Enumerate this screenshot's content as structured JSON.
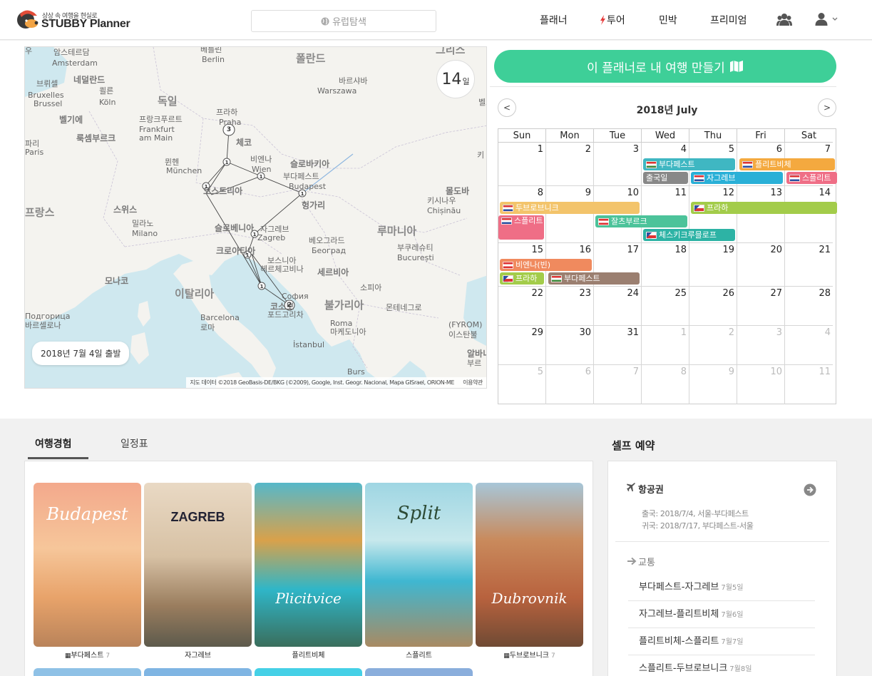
{
  "header": {
    "logo_tagline": "상상 속 여행을 현실로",
    "logo_name": "STUBBY Planner",
    "search_placeholder": "유럽탐색",
    "nav": {
      "planner": "플래너",
      "tour": "투어",
      "lodging": "민박",
      "premium": "프리미엄"
    },
    "icons": [
      "globe-icon",
      "bolt-icon",
      "group-icon",
      "user-icon",
      "chevron-down-icon"
    ]
  },
  "map": {
    "days_number": "14",
    "days_unit": "일",
    "departure": "2018년 7월 4일 출발",
    "attribution": "지도 데이터 ©2018 GeoBasis-DE/BKG (©2009), Google, Inst. Geogr. Nacional, Mapa GISrael, ORION-ME",
    "terms": "이용약관",
    "labels": [
      {
        "t": "폴란드",
        "c": "big"
      },
      {
        "t": "독일",
        "c": "big"
      },
      {
        "t": "이탈리아",
        "c": "big"
      },
      {
        "t": "루마니아",
        "c": "big"
      },
      {
        "t": "프랑스",
        "c": "big"
      },
      {
        "t": "암스테르담"
      },
      {
        "t": "Amsterdam"
      },
      {
        "t": "베를린"
      },
      {
        "t": "Berlin"
      },
      {
        "t": "네덜란드",
        "c": "country"
      },
      {
        "t": "브뤼셀"
      },
      {
        "t": "Bruxelles"
      },
      {
        "t": "Brussel"
      },
      {
        "t": "쾰른"
      },
      {
        "t": "Köln"
      },
      {
        "t": "벨기에",
        "c": "country"
      },
      {
        "t": "바르샤바"
      },
      {
        "t": "Warszawa"
      },
      {
        "t": "프라하"
      },
      {
        "t": "Praha"
      },
      {
        "t": "프랑크푸르트"
      },
      {
        "t": "Frankfurt"
      },
      {
        "t": "am Main"
      },
      {
        "t": "룩셈부르크",
        "c": "country"
      },
      {
        "t": "체코",
        "c": "country"
      },
      {
        "t": "파리"
      },
      {
        "t": "Paris"
      },
      {
        "t": "뮌헨"
      },
      {
        "t": "München"
      },
      {
        "t": "비엔나"
      },
      {
        "t": "Wien"
      },
      {
        "t": "슬로바키아",
        "c": "country"
      },
      {
        "t": "부다페스트"
      },
      {
        "t": "Budapest"
      },
      {
        "t": "오스트리아",
        "c": "country"
      },
      {
        "t": "몰도바",
        "c": "country"
      },
      {
        "t": "키시나우"
      },
      {
        "t": "Chișinău"
      },
      {
        "t": "스위스",
        "c": "country"
      },
      {
        "t": "헝가리",
        "c": "country"
      },
      {
        "t": "밀라노"
      },
      {
        "t": "Milano"
      },
      {
        "t": "슬로베니아",
        "c": "country"
      },
      {
        "t": "자그레브"
      },
      {
        "t": "Zagreb"
      },
      {
        "t": "베오그라드"
      },
      {
        "t": "Београд"
      },
      {
        "t": "크로아티아",
        "c": "country"
      },
      {
        "t": "부쿠레슈티"
      },
      {
        "t": "București"
      },
      {
        "t": "보스니아"
      },
      {
        "t": "헤르체고비나"
      },
      {
        "t": "세르비아",
        "c": "country"
      },
      {
        "t": "모나코",
        "c": "country"
      },
      {
        "t": "소피아"
      },
      {
        "t": "София"
      },
      {
        "t": "몬테네그로"
      },
      {
        "t": "불가리아",
        "c": "big"
      },
      {
        "t": "코소보",
        "c": "country"
      },
      {
        "t": "포드고리차"
      },
      {
        "t": "Подгорица"
      },
      {
        "t": "바르셀로나"
      },
      {
        "t": "Barcelona"
      },
      {
        "t": "로마"
      },
      {
        "t": "Roma"
      },
      {
        "t": "마케도니아"
      },
      {
        "t": "(FYROM)"
      },
      {
        "t": "이스탄불"
      },
      {
        "t": "İstanbul"
      },
      {
        "t": "알바니아",
        "c": "country"
      },
      {
        "t": "부르"
      },
      {
        "t": "Burs"
      },
      {
        "t": "그리스",
        "c": "big"
      },
      {
        "t": "벨로루시"
      },
      {
        "t": "키"
      },
      {
        "t": "우"
      }
    ],
    "route_labels": [
      "3",
      "1",
      "1",
      "1",
      "1",
      "1",
      "1",
      "1",
      "2",
      "1"
    ]
  },
  "cta_label": "이 플래너로 내 여행 만들기",
  "calendar": {
    "title": "2018년 July",
    "prev": "<",
    "next": ">",
    "weekdays": [
      "Sun",
      "Mon",
      "Tue",
      "Wed",
      "Thu",
      "Fri",
      "Sat"
    ],
    "weeks": [
      [
        "1",
        "2",
        "3",
        "4",
        "5",
        "6",
        "7"
      ],
      [
        "8",
        "9",
        "10",
        "11",
        "12",
        "13",
        "14"
      ],
      [
        "15",
        "16",
        "17",
        "18",
        "19",
        "20",
        "21"
      ],
      [
        "22",
        "23",
        "24",
        "25",
        "26",
        "27",
        "28"
      ],
      [
        "29",
        "30",
        "31",
        "1",
        "2",
        "3",
        "4"
      ],
      [
        "5",
        "6",
        "7",
        "8",
        "9",
        "10",
        "11"
      ]
    ],
    "events": [
      {
        "label": "부다페스트",
        "flag": "hu",
        "color": "#3fb7c2"
      },
      {
        "label": "플리트비체",
        "flag": "hr",
        "color": "#f4a93f"
      },
      {
        "label": "출국일",
        "flag": "",
        "color": "#888888"
      },
      {
        "label": "자그레브",
        "flag": "hr",
        "color": "#2ab0d7"
      },
      {
        "label": "스플리트",
        "flag": "hr",
        "color": "#ef6e86"
      },
      {
        "label": "두브로브니크",
        "flag": "hr",
        "color": "#f3c46b"
      },
      {
        "label": "프라하",
        "flag": "cz",
        "color": "#a3cc4a"
      },
      {
        "label": "스플리트",
        "flag": "hr",
        "color": "#ef6e86"
      },
      {
        "label": "잘츠부르크",
        "flag": "at",
        "color": "#4cc39a"
      },
      {
        "label": "체스키크루믈로프",
        "flag": "cz",
        "color": "#2db3a5"
      },
      {
        "label": "비엔나(빈)",
        "flag": "at",
        "color": "#f08a5e"
      },
      {
        "label": "프라하",
        "flag": "cz",
        "color": "#a3cc4a"
      },
      {
        "label": "부다페스트",
        "flag": "hu",
        "color": "#9b7f70"
      }
    ]
  },
  "tabs": {
    "experience": "여행경험",
    "schedule": "일정표"
  },
  "cards": [
    {
      "name": "부다페스트",
      "count": "7",
      "script": "Budapest"
    },
    {
      "name": "자그레브",
      "count": "",
      "script": "ZAGREB"
    },
    {
      "name": "플리트비체",
      "count": "",
      "script": "Plicitvice"
    },
    {
      "name": "스플리트",
      "count": "",
      "script": "Split"
    },
    {
      "name": "두브로브니크",
      "count": "7",
      "script": "Dubrovnik"
    }
  ],
  "self_booking": {
    "title": "셀프 예약",
    "flight_title": "항공권",
    "flight_out": "출국: 2018/7/4, 서울-부다페스트",
    "flight_back": "귀국: 2018/7/17, 부다페스트-서울",
    "transport_title": "교통",
    "transport": [
      {
        "route": "부다페스트-자그레브",
        "date": "7월5일"
      },
      {
        "route": "자그레브-플리트비체",
        "date": "7월6일"
      },
      {
        "route": "플리트비체-스플리트",
        "date": "7월7일"
      },
      {
        "route": "스플리트-두브로브니크",
        "date": "7월8일"
      }
    ]
  },
  "colors": {
    "accent": "#3ecf98",
    "map_water": "#cfe8ef",
    "map_land": "#f4f3ef"
  }
}
